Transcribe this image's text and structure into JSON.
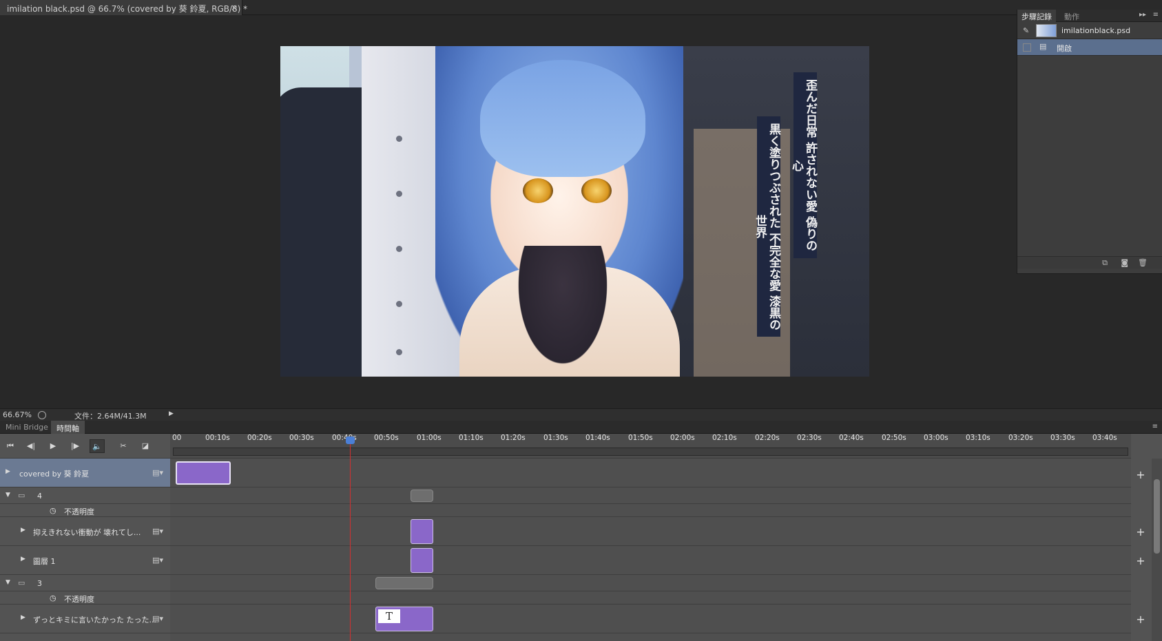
{
  "document_tab": {
    "title": "imilation black.psd @ 66.7% (covered by 葵 鈴夏, RGB/8) *",
    "close": "×"
  },
  "canvas": {
    "text_right": "歪んだ日常 許されない愛 偽りの心",
    "text_left": "黒く塗りつぶされた 不完全な愛 漆黒の世界"
  },
  "status": {
    "zoom": "66.67%",
    "file_info": "文件：2.64M/41.3M"
  },
  "bottom_tabs": {
    "mini_bridge": "Mini Bridge",
    "timeline": "時間軸"
  },
  "timeline": {
    "ticks": [
      "00",
      "00:10s",
      "00:20s",
      "00:30s",
      "00:40s",
      "00:50s",
      "01:00s",
      "01:10s",
      "01:20s",
      "01:30s",
      "01:40s",
      "01:50s",
      "02:00s",
      "02:10s",
      "02:20s",
      "02:30s",
      "02:40s",
      "02:50s",
      "03:00s",
      "03:10s",
      "03:20s",
      "03:30s",
      "03:40s"
    ],
    "layers": {
      "l1": "covered by 葵 鈴夏",
      "g4": "4",
      "op1": "不透明度",
      "l2": "抑えきれない衝動が 壊れてし...",
      "l3": "圖層 1",
      "g3": "3",
      "op2": "不透明度",
      "l4": "ずっとキミに言いたかった たった..."
    },
    "clip_text_icon": "T"
  },
  "history_panel": {
    "tab_history": "步驟記錄",
    "tab_actions": "動作",
    "snapshot": "imilationblack.psd",
    "step_open": "開啟"
  }
}
